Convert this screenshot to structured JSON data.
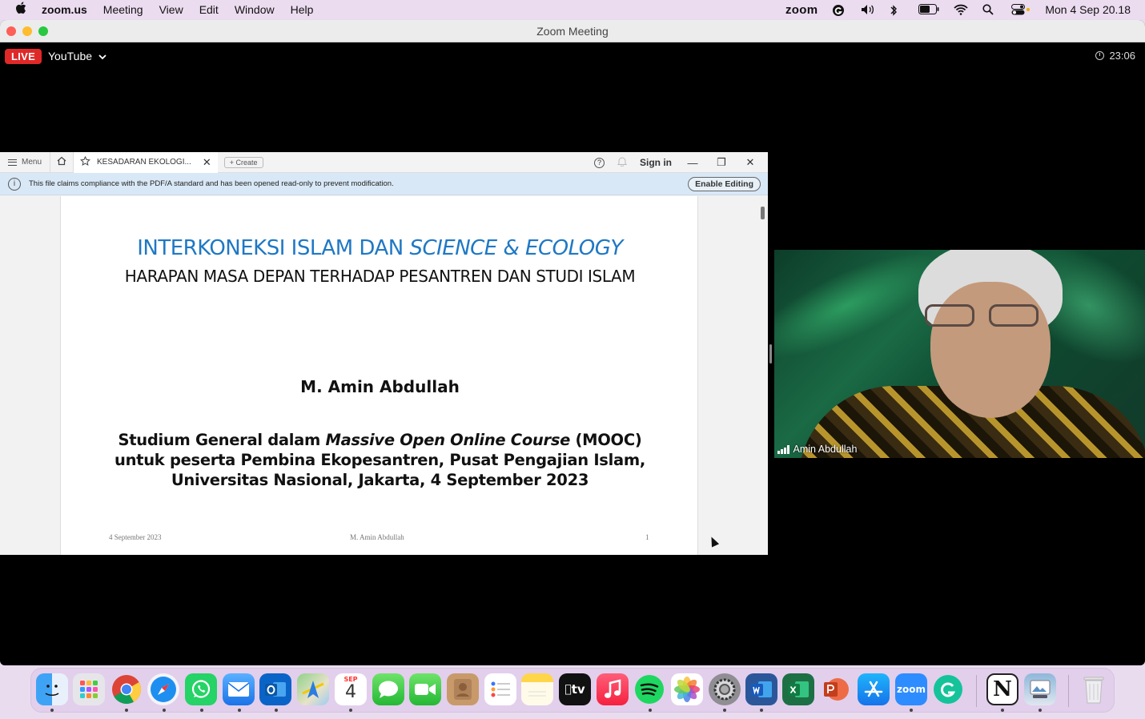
{
  "menubar": {
    "app": "zoom.us",
    "items": [
      "Meeting",
      "View",
      "Edit",
      "Window",
      "Help"
    ],
    "zoom_label": "zoom",
    "datetime": "Mon 4 Sep 20.18"
  },
  "window": {
    "title": "Zoom Meeting",
    "live_badge": "LIVE",
    "stream_target": "YouTube",
    "elapsed": "23:06"
  },
  "viewer": {
    "menu_label": "Menu",
    "tab_title": "KESADARAN EKOLOGI...",
    "create_label": "Create",
    "signin_label": "Sign in",
    "info_text": "This file claims compliance with the PDF/A standard and has been opened read-only to prevent modification.",
    "enable_editing": "Enable Editing"
  },
  "slide": {
    "title_part1": "INTERKONEKSI ISLAM DAN ",
    "title_part2": "SCIENCE & ECOLOGY",
    "subtitle": "HARAPAN MASA DEPAN TERHADAP PESANTREN DAN STUDI ISLAM",
    "author": "M. Amin Abdullah",
    "body_part1": "Studium General dalam ",
    "body_italic": "Massive Open Online Course",
    "body_part2": " (MOOC) untuk peserta Pembina Ekopesantren, Pusat Pengajian Islam, Universitas Nasional, Jakarta, 4 September 2023",
    "footer_date": "4 September 2023",
    "footer_author": "M. Amin Abdullah",
    "footer_page": "1"
  },
  "participant": {
    "name": "Amin Abdullah"
  },
  "dock": {
    "calendar_month": "SEP",
    "calendar_day": "4",
    "appletv_label": "tv",
    "zoom_label": "zoom",
    "notion_label": "N"
  },
  "colors": {
    "live": "#e02828",
    "slide_title": "#1f78c4",
    "infobar": "#d9e8f6"
  }
}
